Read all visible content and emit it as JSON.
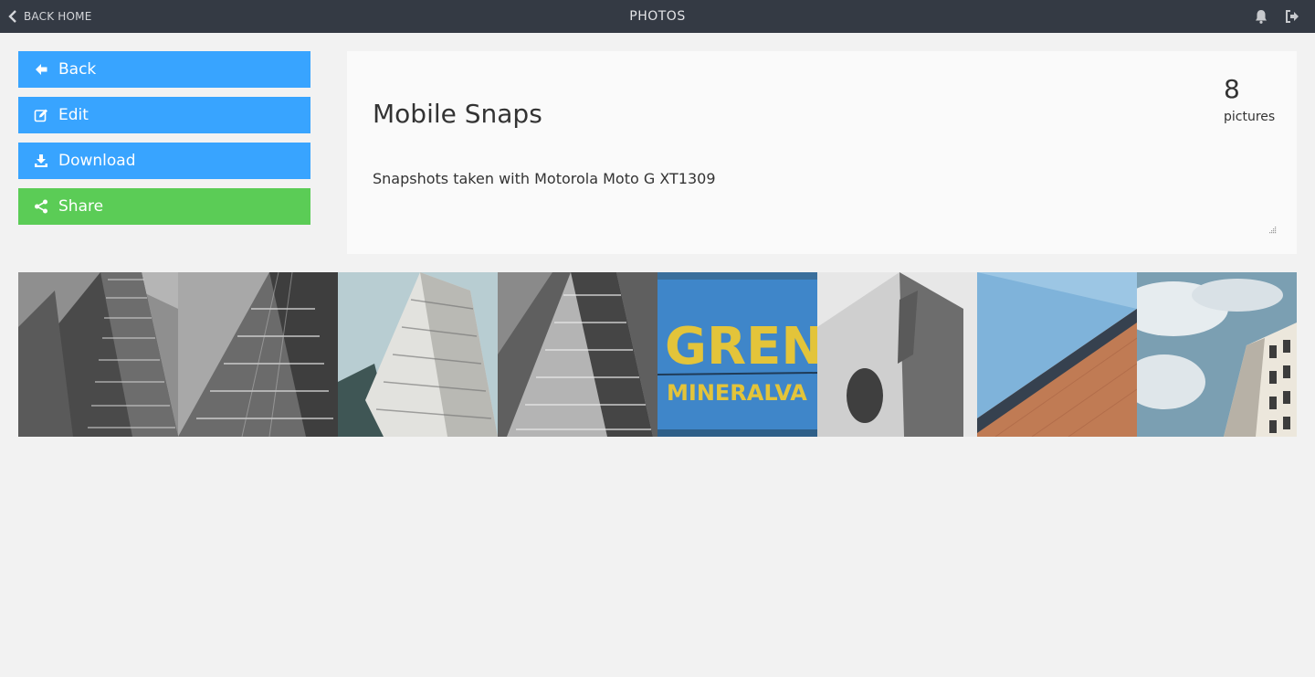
{
  "topbar": {
    "back_label": "BACK HOME",
    "title": "PHOTOS",
    "icons": [
      "bell-icon",
      "sign-out-icon"
    ]
  },
  "sidebar": {
    "buttons": [
      {
        "label": "Back",
        "icon": "arrow-left-icon",
        "color": "#38a4ff"
      },
      {
        "label": "Edit",
        "icon": "edit-icon",
        "color": "#38a4ff"
      },
      {
        "label": "Download",
        "icon": "download-icon",
        "color": "#38a4ff"
      },
      {
        "label": "Share",
        "icon": "share-icon",
        "color": "#5bcc56"
      }
    ]
  },
  "album": {
    "title": "Mobile Snaps",
    "description": "Snapshots taken with Motorola Moto G XT1309",
    "count": "8",
    "count_label": "pictures"
  },
  "gallery": {
    "photos": [
      {
        "subject": "grayscale skyscraper"
      },
      {
        "subject": "grayscale skyscraper facade"
      },
      {
        "subject": "skyscraper against sky"
      },
      {
        "subject": "grayscale skyscraper"
      },
      {
        "subject": "painted sign",
        "text_line1": "GREN",
        "text_line2": "MINERALVA"
      },
      {
        "subject": "concrete wall with circle"
      },
      {
        "subject": "brick building and blue sky"
      },
      {
        "subject": "tower under cloudy sky"
      }
    ]
  }
}
